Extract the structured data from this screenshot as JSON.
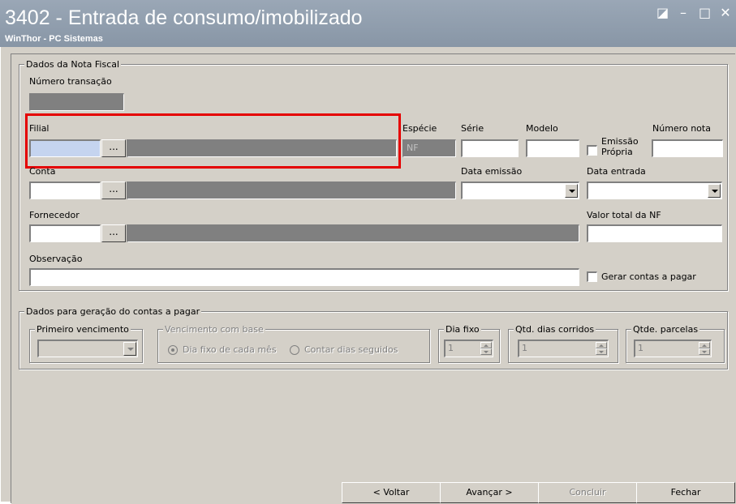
{
  "window": {
    "title": "3402 - Entrada de consumo/imobilizado",
    "subtitle": "WinThor - PC Sistemas",
    "controls": [
      "restore-icon",
      "minimize-icon",
      "maximize-icon",
      "close-icon"
    ]
  },
  "nota_fiscal": {
    "legend": "Dados da Nota Fiscal",
    "numero_transacao_label": "Número transação",
    "filial_label": "Filial",
    "especie_label": "Espécie",
    "especie_value": "NF",
    "serie_label": "Série",
    "modelo_label": "Modelo",
    "emissao_propria_label_1": "Emissão",
    "emissao_propria_label_2": "Própria",
    "numero_nota_label": "Número nota",
    "conta_label": "Conta",
    "data_emissao_label": "Data emissão",
    "data_entrada_label": "Data entrada",
    "fornecedor_label": "Fornecedor",
    "valor_total_label": "Valor total da NF",
    "observacao_label": "Observação",
    "gerar_contas_label": "Gerar contas a pagar",
    "ellipsis": "..."
  },
  "contas_pagar": {
    "legend": "Dados para geração do contas a pagar",
    "primeiro_vencimento_legend": "Primeiro vencimento",
    "vencimento_base_legend": "Vencimento com base",
    "radio_dia_fixo": "Dia fixo de cada mês",
    "radio_contar_dias": "Contar dias seguidos",
    "dia_fixo_legend": "Dia fixo",
    "dia_fixo_value": "1",
    "qtd_dias_legend": "Qtd. dias corridos",
    "qtd_dias_value": "1",
    "qtde_parcelas_legend": "Qtde. parcelas",
    "qtde_parcelas_value": "1"
  },
  "buttons": {
    "voltar": "< Voltar",
    "avancar": "Avançar >",
    "concluir": "Concluir",
    "fechar": "Fechar"
  },
  "colors": {
    "titlebar": "#8e9cac",
    "highlight": "#e50000",
    "face": "#d4d0c8"
  }
}
